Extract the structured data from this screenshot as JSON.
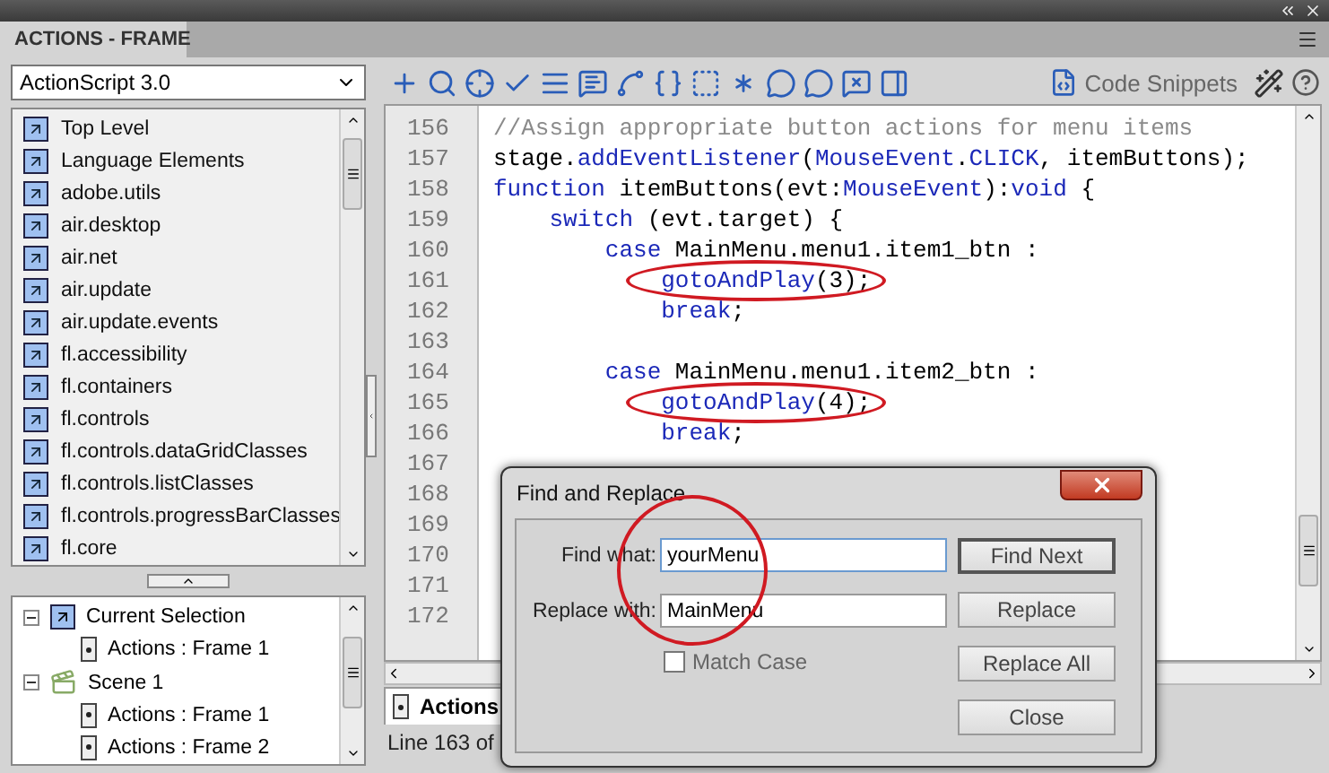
{
  "panel": {
    "title": "ACTIONS - FRAME"
  },
  "language_select": {
    "value": "ActionScript 3.0"
  },
  "library": [
    "Top Level",
    "Language Elements",
    "adobe.utils",
    "air.desktop",
    "air.net",
    "air.update",
    "air.update.events",
    "fl.accessibility",
    "fl.containers",
    "fl.controls",
    "fl.controls.dataGridClasses",
    "fl.controls.listClasses",
    "fl.controls.progressBarClasses",
    "fl.core"
  ],
  "tree": [
    {
      "label": "Current Selection",
      "kind": "selection",
      "expanded": true,
      "children": [
        {
          "label": "Actions : Frame 1",
          "kind": "frame"
        }
      ]
    },
    {
      "label": "Scene 1",
      "kind": "scene",
      "expanded": true,
      "children": [
        {
          "label": "Actions : Frame 1",
          "kind": "frame"
        },
        {
          "label": "Actions : Frame 2",
          "kind": "frame"
        }
      ]
    }
  ],
  "toolbar": {
    "snippets_label": "Code Snippets"
  },
  "code_lines": [
    {
      "number": "156",
      "tokens": [
        {
          "kind": "comment",
          "text": "//Assign appropriate button actions for menu items"
        }
      ]
    },
    {
      "number": "157",
      "tokens": [
        {
          "kind": "plain",
          "text": "stage."
        },
        {
          "kind": "keyword",
          "text": "addEventListener"
        },
        {
          "kind": "plain",
          "text": "("
        },
        {
          "kind": "keyword",
          "text": "MouseEvent"
        },
        {
          "kind": "plain",
          "text": "."
        },
        {
          "kind": "keyword",
          "text": "CLICK"
        },
        {
          "kind": "plain",
          "text": ", itemButtons);"
        }
      ]
    },
    {
      "number": "158",
      "tokens": [
        {
          "kind": "keyword",
          "text": "function"
        },
        {
          "kind": "plain",
          "text": " itemButtons(evt:"
        },
        {
          "kind": "keyword",
          "text": "MouseEvent"
        },
        {
          "kind": "plain",
          "text": "):"
        },
        {
          "kind": "keyword",
          "text": "void"
        },
        {
          "kind": "plain",
          "text": " {"
        }
      ]
    },
    {
      "number": "159",
      "tokens": [
        {
          "kind": "keyword",
          "text": "    switch"
        },
        {
          "kind": "plain",
          "text": " (evt.target) {"
        }
      ]
    },
    {
      "number": "160",
      "tokens": [
        {
          "kind": "keyword",
          "text": "        case"
        },
        {
          "kind": "plain",
          "text": " MainMenu.menu1.item1_btn :"
        }
      ]
    },
    {
      "number": "161",
      "tokens": [
        {
          "kind": "keyword",
          "text": "            gotoAndPlay",
          "circled": true,
          "rest": "(3);"
        }
      ]
    },
    {
      "number": "162",
      "tokens": [
        {
          "kind": "keyword",
          "text": "            break"
        },
        {
          "kind": "plain",
          "text": ";"
        }
      ]
    },
    {
      "number": "163"
    },
    {
      "number": "164",
      "tokens": [
        {
          "kind": "keyword",
          "text": "        case"
        },
        {
          "kind": "plain",
          "text": " MainMenu.menu1.item2_btn :"
        }
      ]
    },
    {
      "number": "165",
      "tokens": [
        {
          "kind": "keyword",
          "text": "            gotoAndPlay",
          "circled": true,
          "rest": "(4);"
        }
      ]
    },
    {
      "number": "166",
      "tokens": [
        {
          "kind": "keyword",
          "text": "            break"
        },
        {
          "kind": "plain",
          "text": ";"
        }
      ]
    },
    {
      "number": "167"
    },
    {
      "number": "168"
    },
    {
      "number": "169"
    },
    {
      "number": "170"
    },
    {
      "number": "171"
    },
    {
      "number": "172"
    }
  ],
  "script_tab": {
    "label": "Actions",
    "selected": true
  },
  "status_bar": "Line 163 of",
  "dialog": {
    "title": "Find and Replace",
    "circled": true,
    "fields": [
      {
        "label": "Find what:",
        "value": "yourMenu",
        "focused": true
      },
      {
        "label": "Replace with:",
        "value": "MainMenu",
        "focused": false
      }
    ],
    "match_case": {
      "label": "Match Case",
      "checked": false
    },
    "buttons": [
      {
        "label": "Find Next",
        "default": true
      },
      {
        "label": "Replace",
        "default": false
      },
      {
        "label": "Replace All",
        "default": false
      },
      {
        "label": "Close",
        "default": false
      }
    ]
  }
}
